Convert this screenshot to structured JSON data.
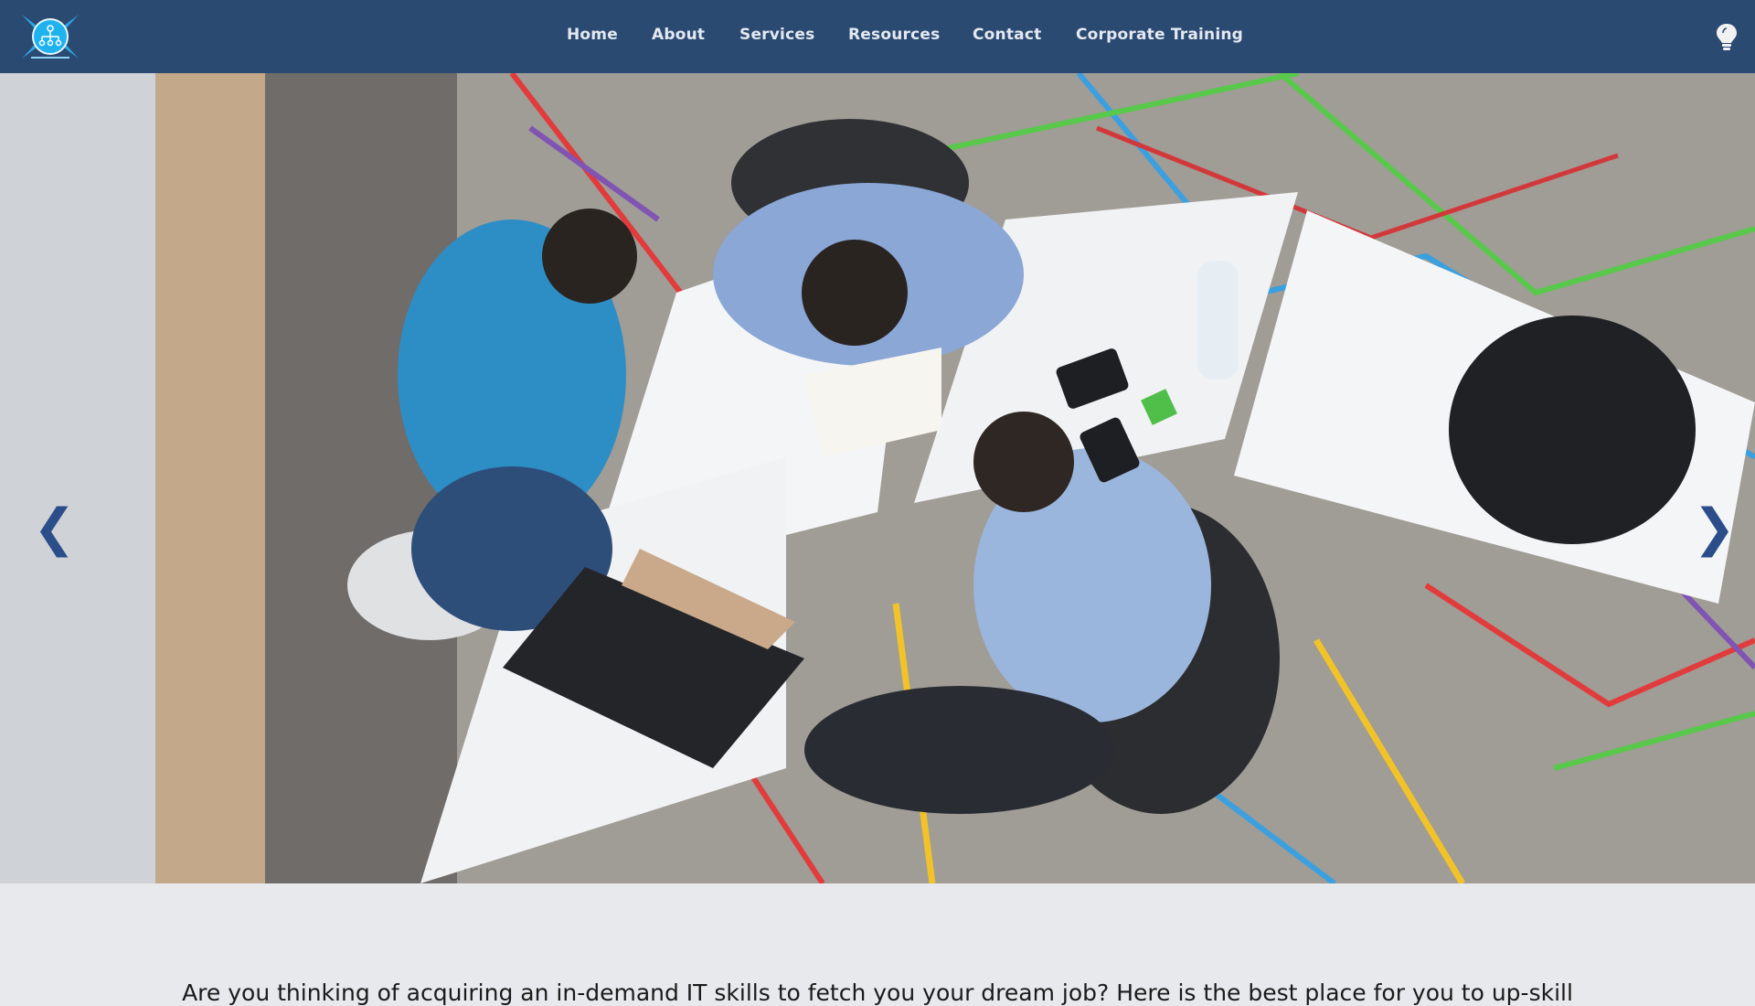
{
  "nav": {
    "logo_icon": "network-hub-logo-icon",
    "items": [
      {
        "label": "Home"
      },
      {
        "label": "About"
      },
      {
        "label": "Services"
      },
      {
        "label": "Resources"
      },
      {
        "label": "Contact"
      },
      {
        "label": "Corporate Training"
      }
    ],
    "theme_toggle_icon": "lightbulb-icon"
  },
  "hero": {
    "image": "team-collaborating-around-laptop-photo",
    "prev_arrow": "❮",
    "next_arrow": "❯"
  },
  "intro": {
    "tagline": "Are you thinking of acquiring an in-demand IT skills to fetch you your dream job? Here is the best place for you to up-skill"
  },
  "colors": {
    "navbar": "#2a4a72",
    "page_background": "#e8e9ec",
    "arrow": "#2b4e8a"
  }
}
